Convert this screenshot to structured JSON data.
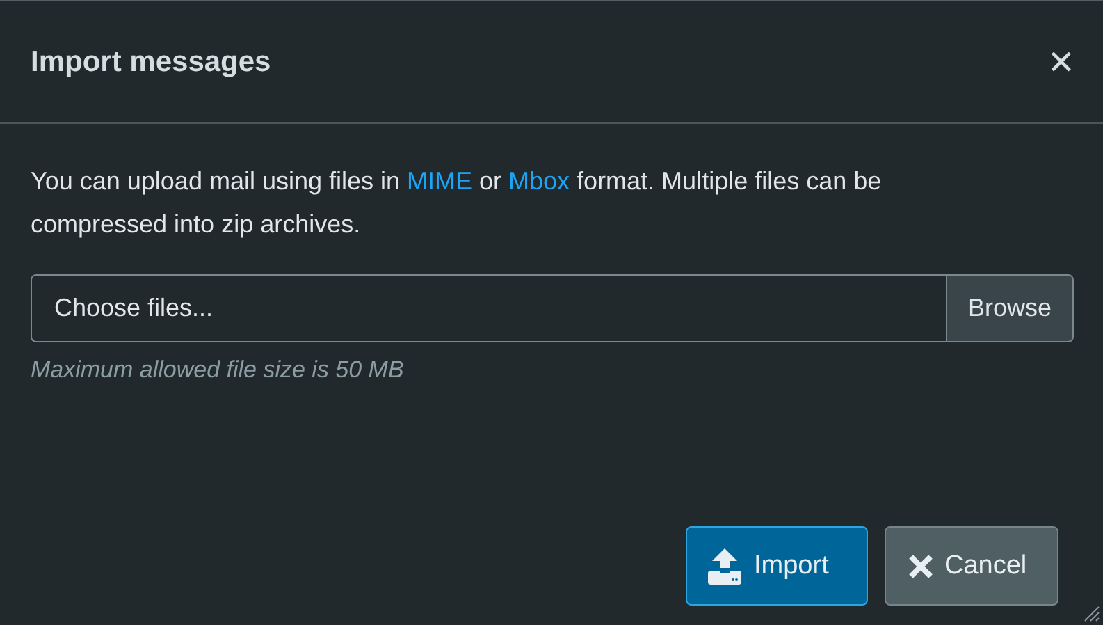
{
  "dialog": {
    "title": "Import messages",
    "close": "✕"
  },
  "description": [
    {
      "kind": "text",
      "text": "You can upload mail using files in "
    },
    {
      "kind": "link",
      "text": "MIME"
    },
    {
      "kind": "text",
      "text": " or "
    },
    {
      "kind": "link",
      "text": "Mbox"
    },
    {
      "kind": "text",
      "text": " format. Multiple files can be compressed into zip archives."
    }
  ],
  "file_input": {
    "placeholder": "Choose files...",
    "button": "Browse"
  },
  "hint": "Maximum allowed file size is 50 MB",
  "buttons": [
    {
      "kind": "import",
      "label": "Import"
    },
    {
      "kind": "cancel",
      "label": "Cancel"
    }
  ]
}
